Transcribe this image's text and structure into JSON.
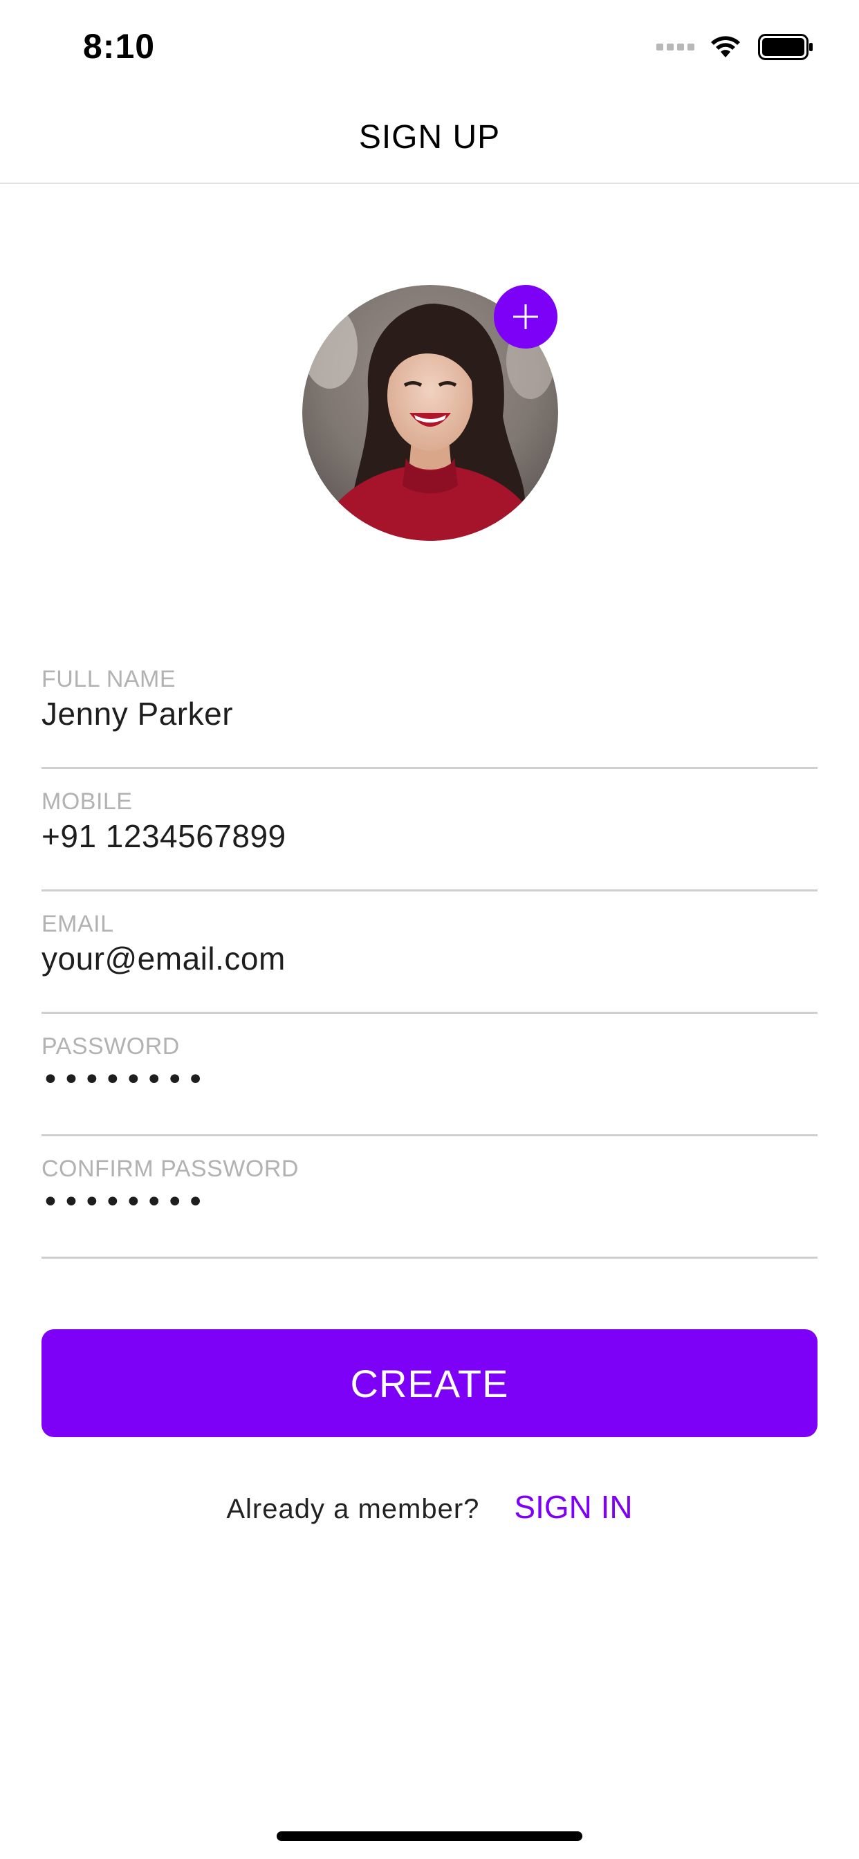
{
  "status_bar": {
    "time": "8:10",
    "icons": [
      "signal-icon",
      "wifi-icon",
      "battery-icon"
    ]
  },
  "nav": {
    "title": "SIGN UP"
  },
  "profile": {
    "add_photo_icon": "plus-icon"
  },
  "form": {
    "full_name": {
      "label": "FULL NAME",
      "value": "Jenny Parker"
    },
    "mobile": {
      "label": "MOBILE",
      "value": "+91 1234567899"
    },
    "email": {
      "label": "EMAIL",
      "value": "your@email.com"
    },
    "password": {
      "label": "PASSWORD",
      "value": "••••••••"
    },
    "confirm_password": {
      "label": "CONFIRM PASSWORD",
      "value": "••••••••"
    }
  },
  "actions": {
    "create_label": "CREATE",
    "signin_prompt": "Already a member?",
    "signin_label": "SIGN IN"
  },
  "colors": {
    "accent": "#7d00f7",
    "label": "#b2b2b2",
    "divider": "#cfcfcf"
  }
}
